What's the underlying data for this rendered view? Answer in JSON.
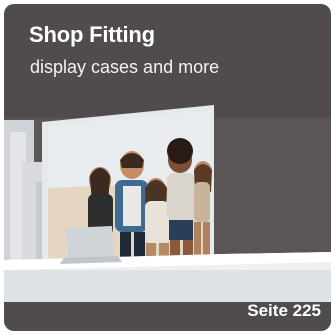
{
  "card": {
    "title": "Shop Fitting",
    "subtitle": "display cases and more",
    "page_ref": "Seite 225",
    "image_icon": "shop-display-photo",
    "colors": {
      "background": "#504c4d",
      "text": "#ffffff"
    }
  }
}
